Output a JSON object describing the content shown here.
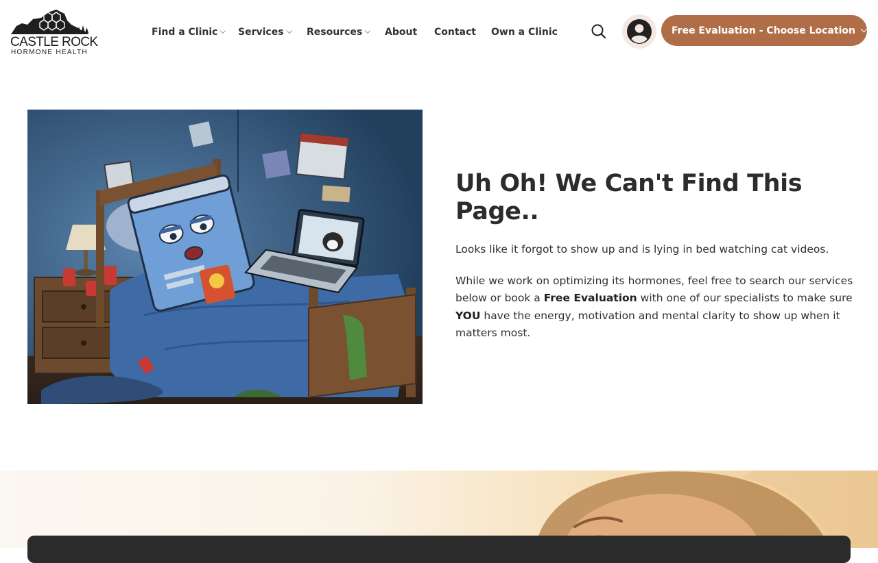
{
  "brand": {
    "name_line1": "CASTLE ROCK",
    "name_line2": "HORMONE HEALTH"
  },
  "nav": {
    "items": [
      {
        "label": "Find a Clinic",
        "has_dropdown": true
      },
      {
        "label": "Services",
        "has_dropdown": true
      },
      {
        "label": "Resources",
        "has_dropdown": true
      },
      {
        "label": "About",
        "has_dropdown": false
      },
      {
        "label": "Contact",
        "has_dropdown": false
      },
      {
        "label": "Own a Clinic",
        "has_dropdown": false
      }
    ]
  },
  "header": {
    "search_icon": "search-icon",
    "account_icon": "user-circle-icon",
    "cta_label": "Free Evaluation - Choose Location",
    "cta_icon": "chevron-down-icon"
  },
  "error": {
    "title": "Uh Oh! We Can't Find This Page..",
    "para1": "Looks like it forgot to show up and is lying in bed watching cat videos.",
    "para2": {
      "part1": "While we work on optimizing its hormones, feel free to search our services below or book a ",
      "bold1": "Free Evaluation",
      "part2": " with one of our specialists to make sure ",
      "bold2": "YOU",
      "part3": " have the energy, motivation and mental clarity to show up when it matters most."
    }
  },
  "colors": {
    "accent": "#b06e48",
    "text": "#2c2c2c",
    "panel": "#2b2b2b"
  }
}
